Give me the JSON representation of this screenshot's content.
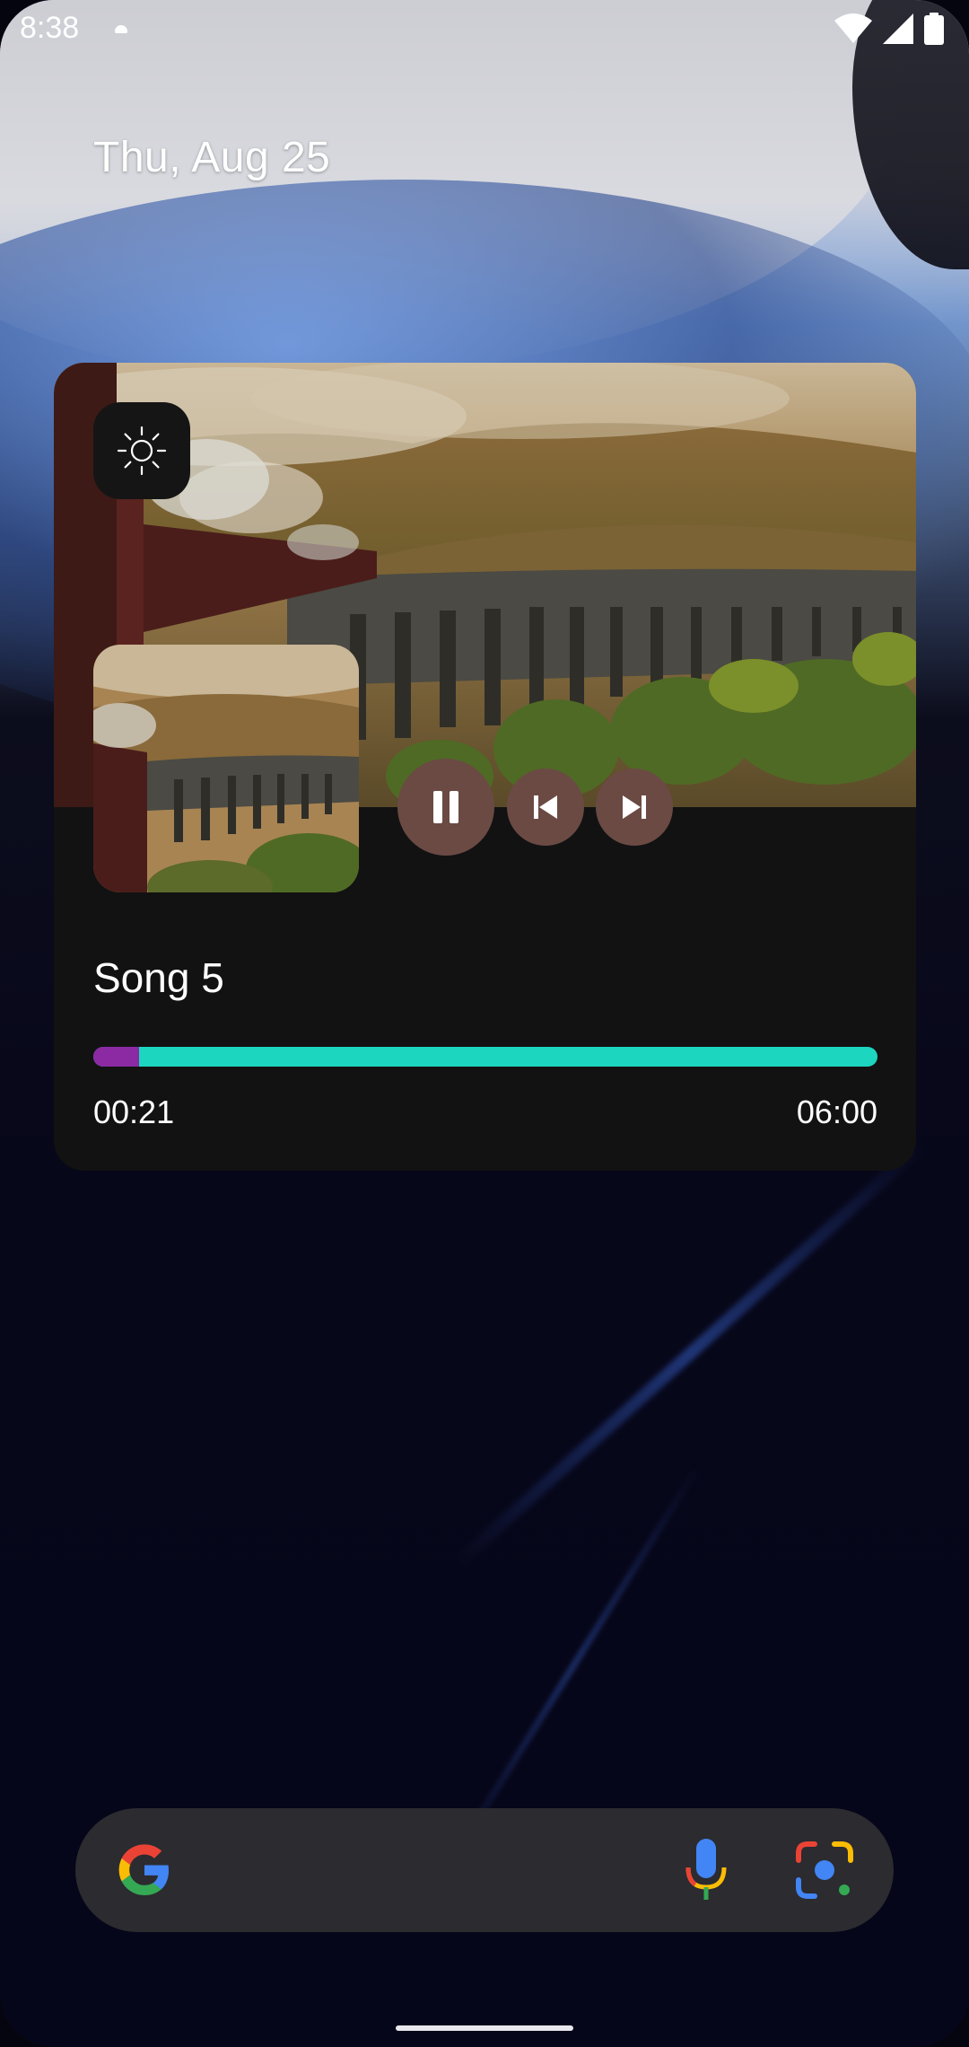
{
  "status_bar": {
    "time": "8:38",
    "icons": [
      "cloud-icon",
      "wifi-icon",
      "cell-signal-icon",
      "battery-icon"
    ]
  },
  "date": "Thu, Aug 25",
  "media_widget": {
    "theme_icon": "sun-icon",
    "controls": [
      "pause-icon",
      "skip-previous-icon",
      "skip-next-icon"
    ],
    "song_title": "Song 5",
    "elapsed": "00:21",
    "duration": "06:00",
    "progress_fraction": 0.058,
    "colors": {
      "card_background": "#121212",
      "progress_played": "#8b2aa3",
      "progress_remaining": "#1dd6bf",
      "control_button": "#6b4a44"
    }
  },
  "search_bar": {
    "icons": [
      "google-logo-icon",
      "microphone-icon",
      "lens-icon"
    ]
  }
}
